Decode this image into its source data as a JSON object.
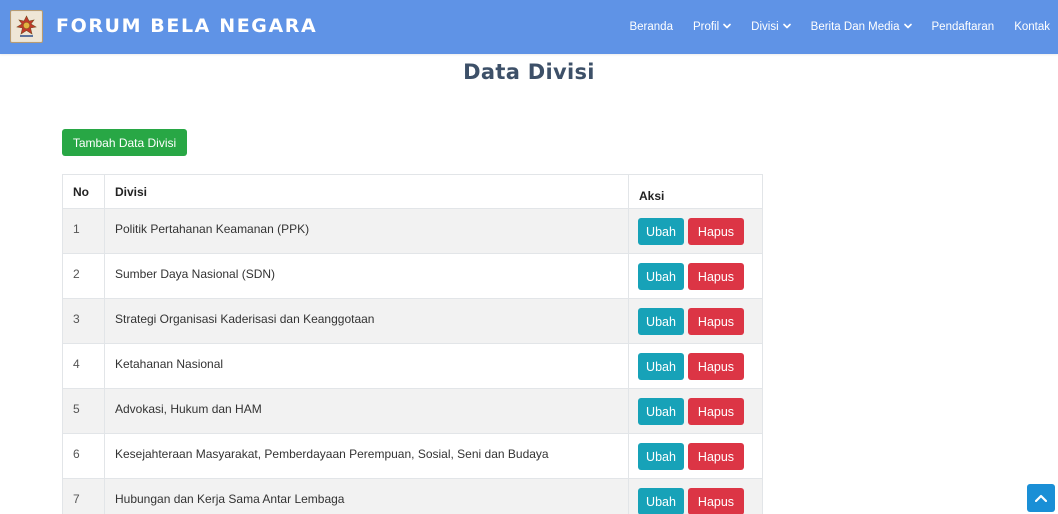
{
  "brand": {
    "name": "FORUM BELA NEGARA",
    "logo_icon": "garuda-emblem-icon"
  },
  "nav": {
    "items": [
      {
        "label": "Beranda",
        "dropdown": false
      },
      {
        "label": "Profil",
        "dropdown": true
      },
      {
        "label": "Divisi",
        "dropdown": true
      },
      {
        "label": "Berita Dan Media",
        "dropdown": true
      },
      {
        "label": "Pendaftaran",
        "dropdown": false
      },
      {
        "label": "Kontak",
        "dropdown": false
      }
    ]
  },
  "page": {
    "title": "Data Divisi",
    "add_button": "Tambah Data Divisi"
  },
  "table": {
    "headers": [
      "No",
      "Divisi",
      "Aksi"
    ],
    "rows": [
      {
        "no": "1",
        "divisi": "Politik Pertahanan Keamanan (PPK)"
      },
      {
        "no": "2",
        "divisi": "Sumber Daya Nasional (SDN)"
      },
      {
        "no": "3",
        "divisi": "Strategi Organisasi Kaderisasi dan Keanggotaan"
      },
      {
        "no": "4",
        "divisi": "Ketahanan Nasional"
      },
      {
        "no": "5",
        "divisi": "Advokasi, Hukum dan HAM"
      },
      {
        "no": "6",
        "divisi": "Kesejahteraan Masyarakat, Pemberdayaan Perempuan, Sosial, Seni dan Budaya"
      },
      {
        "no": "7",
        "divisi": "Hubungan dan Kerja Sama Antar Lembaga"
      }
    ],
    "edit_label": "Ubah",
    "delete_label": "Hapus"
  },
  "colors": {
    "navbar": "#5f93e6",
    "add_button": "#28a745",
    "edit_button": "#17a2b8",
    "delete_button": "#dc3545",
    "scroll_top": "#1a8fd6"
  },
  "scroll_top_icon": "chevron-up-icon"
}
